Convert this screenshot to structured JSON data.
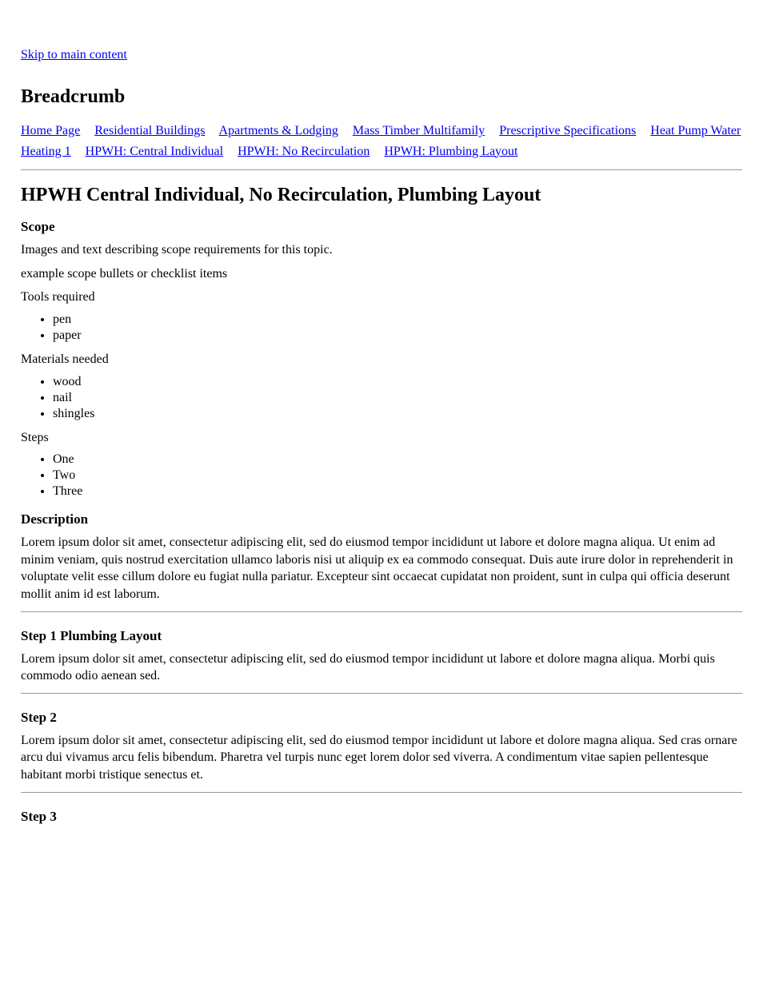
{
  "skipLink": "Skip to main content",
  "breadcrumbHeading": "Breadcrumb",
  "breadcrumbs": [
    "Home Page",
    "Residential Buildings",
    "Apartments & Lodging",
    "Mass Timber Multifamily",
    "Prescriptive Specifications",
    "Heat Pump Water Heating 1",
    "HPWH: Central Individual",
    "HPWH: No Recirculation",
    "HPWH: Plumbing Layout"
  ],
  "docTitle": "HPWH Central Individual, No Recirculation, Plumbing Layout",
  "scopeLabel": "Scope",
  "scopeText": "Images and text describing scope requirements for this topic.",
  "toolsHeading": "example scope bullets or checklist items",
  "lists": [
    {
      "heading": "Tools required",
      "items": [
        "pen",
        "paper"
      ]
    },
    {
      "heading": "Materials needed",
      "items": [
        "wood",
        "nail",
        "shingles"
      ]
    },
    {
      "heading": "Steps",
      "items": [
        "One",
        "Two",
        "Three"
      ]
    }
  ],
  "descLabel": "Description",
  "descText": "Lorem ipsum dolor sit amet, consectetur adipiscing elit, sed do eiusmod tempor incididunt ut labore et dolore magna aliqua. Ut enim ad minim veniam, quis nostrud exercitation ullamco laboris nisi ut aliquip ex ea commodo consequat. Duis aute irure dolor in reprehenderit in voluptate velit esse cillum dolore eu fugiat nulla pariatur. Excepteur sint occaecat cupidatat non proident, sunt in culpa qui officia deserunt mollit anim id est laborum.",
  "steps": [
    {
      "title": "Step 1 Plumbing Layout",
      "body": "Lorem ipsum dolor sit amet, consectetur adipiscing elit, sed do eiusmod tempor incididunt ut labore et dolore magna aliqua. Morbi quis commodo odio aenean sed."
    },
    {
      "title": "Step 2",
      "body": "Lorem ipsum dolor sit amet, consectetur adipiscing elit, sed do eiusmod tempor incididunt ut labore et dolore magna aliqua. Sed cras ornare arcu dui vivamus arcu felis bibendum. Pharetra vel turpis nunc eget lorem dolor sed viverra. A condimentum vitae sapien pellentesque habitant morbi tristique senectus et."
    },
    {
      "title": "Step 3",
      "body": ""
    }
  ]
}
